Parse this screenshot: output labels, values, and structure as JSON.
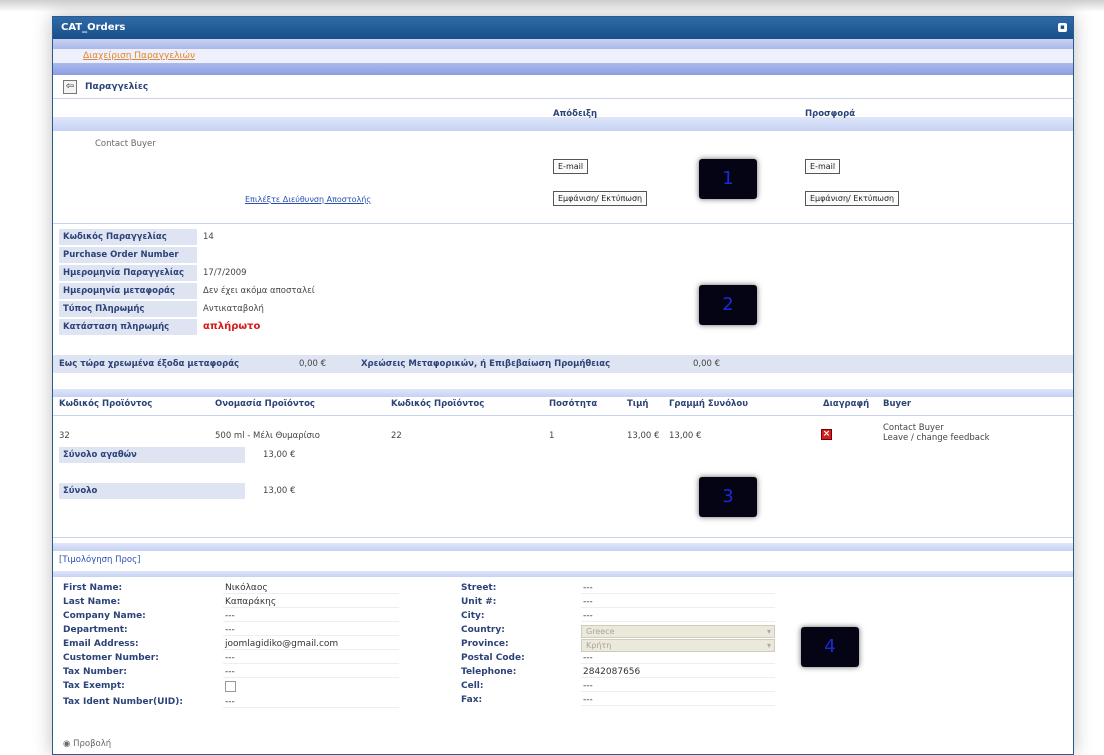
{
  "window": {
    "title": "CAT_Orders"
  },
  "breadcrumb": {
    "link": "Διαχείριση Παραγγελιών"
  },
  "header": {
    "title": "Παραγγελίες"
  },
  "actions": {
    "col_receipt": "Απόδειξη",
    "col_offer": "Προσφορά",
    "contact_buyer": "Contact Buyer",
    "resend_link": "Επιλέξτε Διεύθυνση Αποστολής",
    "email_label": "E-mail",
    "print_label": "Εμφάνιση/ Εκτύπωση",
    "badge1": "1"
  },
  "order_info": {
    "rows": [
      {
        "label": "Κωδικός Παραγγελίας",
        "value": "14"
      },
      {
        "label": "Purchase Order Number",
        "value": ""
      },
      {
        "label": "Ημερομηνία Παραγγελίας",
        "value": "17/7/2009"
      },
      {
        "label": "Ημερομηνία μεταφοράς",
        "value": "Δεν έχει ακόμα αποσταλεί"
      },
      {
        "label": "Τύπος Πληρωμής",
        "value": "Αντικαταβολή"
      },
      {
        "label": "Κατάσταση πληρωμής",
        "value": "απλήρωτο"
      }
    ],
    "badge2": "2"
  },
  "shipping": {
    "label1": "Εως τώρα χρεωμένα έξοδα μεταφοράς",
    "value1": "0,00 €",
    "label2": "Χρεώσεις Μεταφορικών, ή Επιβεβαίωση Προμήθειας",
    "value2": "0,00 €"
  },
  "products": {
    "headers": [
      "Κωδικός Προϊόντος",
      "Ονομασία Προϊόντος",
      "Κωδικός Προϊόντος",
      "Ποσότητα",
      "Τιμή",
      "Γραμμή Συνόλου",
      "Διαγραφή",
      "Buyer"
    ],
    "row": {
      "id": "32",
      "name": "500 ml - Μέλι Θυμαρίσιο",
      "sku": "22",
      "qty": "1",
      "price": "13,00 €",
      "line_total": "13,00 €",
      "buyer_contact": "Contact Buyer",
      "buyer_feedback": "Leave / change feedback"
    },
    "subtotal_label": "Σύνολο αγαθών",
    "subtotal_value": "13,00 €",
    "total_label": "Σύνολο",
    "total_value": "13,00 €",
    "badge3": "3"
  },
  "billing": {
    "title": "[Τιμολόγηση Προς]",
    "left": [
      {
        "label": "First Name:",
        "value": "Νικόλαος"
      },
      {
        "label": "Last Name:",
        "value": "Καπαράκης"
      },
      {
        "label": "Company Name:",
        "value": "---"
      },
      {
        "label": "Department:",
        "value": "---"
      },
      {
        "label": "Email Address:",
        "value": "joomlagidiko@gmail.com"
      },
      {
        "label": "Customer Number:",
        "value": "---"
      },
      {
        "label": "Tax Number:",
        "value": "---"
      },
      {
        "label": "Tax Exempt:",
        "value": ""
      },
      {
        "label": "Tax Ident Number(UID):",
        "value": "---"
      }
    ],
    "right": [
      {
        "label": "Street:",
        "value": "---"
      },
      {
        "label": "Unit #:",
        "value": "---"
      },
      {
        "label": "City:",
        "value": "---"
      },
      {
        "label": "Country:",
        "value": "Greece"
      },
      {
        "label": "Province:",
        "value": "Κρήτη"
      },
      {
        "label": "Postal Code:",
        "value": "---"
      },
      {
        "label": "Telephone:",
        "value": "2842087656"
      },
      {
        "label": "Cell:",
        "value": "---"
      },
      {
        "label": "Fax:",
        "value": "---"
      }
    ],
    "badge4": "4",
    "footer_radio": "Προβολή"
  }
}
